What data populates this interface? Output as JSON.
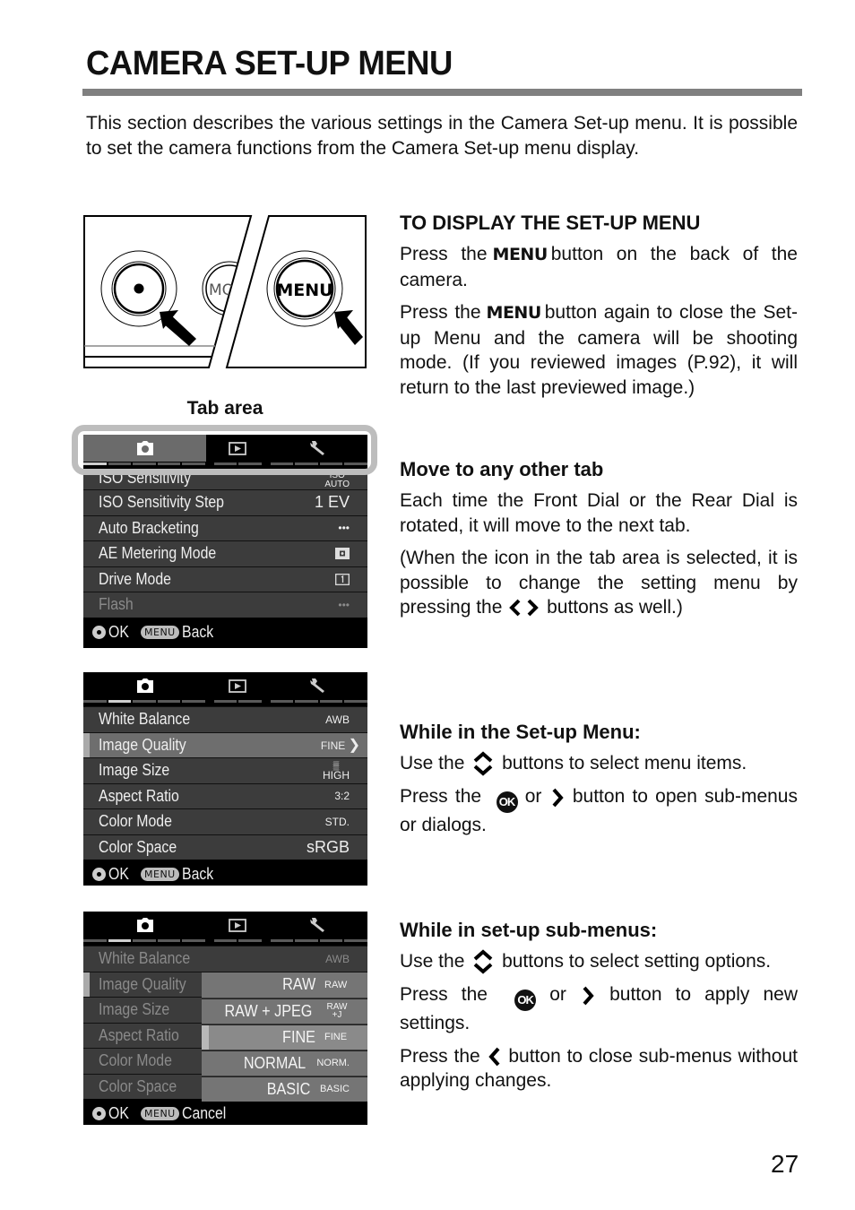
{
  "page": {
    "title": "CAMERA SET-UP MENU",
    "intro": "This section describes the various settings in the Camera Set-up menu. It is possible to set the camera functions from the Camera Set-up menu display.",
    "page_number": "27"
  },
  "camera_illustration": {
    "left_button_label": "MO",
    "menu_button_label": "MENU"
  },
  "tab_area_label": "Tab area",
  "sections": {
    "display": {
      "heading": "TO DISPLAY THE SET-UP MENU",
      "p1_before": "Press the",
      "p1_key": "MENU",
      "p1_after": "button on the back of the camera.",
      "p2_before": "Press the",
      "p2_key": "MENU",
      "p2_after": "button again to close the Set-up Menu and the camera will be shooting mode. (If you reviewed images (P.92), it will return to the last previewed image.)"
    },
    "tabs": {
      "heading": "Move to any other tab",
      "p1": "Each time the Front Dial or the Rear Dial is rotated, it will move to the next tab.",
      "p2_before": "(When the icon in the tab area is selected, it is possible to change the setting menu by pressing the",
      "p2_after": "buttons as well.)"
    },
    "menu": {
      "heading": "While in the Set-up Menu:",
      "p1_before": "Use the",
      "p1_after": "buttons to select menu items.",
      "p2_before": "Press the",
      "p2_ok": "OK",
      "p2_mid": "or",
      "p2_after": "button to open sub-menus or dialogs."
    },
    "submenu": {
      "heading": "While in set-up sub-menus:",
      "p1_before": "Use the",
      "p1_after": "buttons to select setting options.",
      "p2_before": "Press the",
      "p2_ok": "OK",
      "p2_mid": "or",
      "p2_after": "button to apply new settings.",
      "p3_before": "Press the",
      "p3_after": "button to close sub-menus without applying changes."
    }
  },
  "screens": {
    "screen1": {
      "rows": [
        {
          "label": "ISO Sensitivity",
          "value": "ISO AUTO"
        },
        {
          "label": "ISO Sensitivity Step",
          "value": "1 EV"
        },
        {
          "label": "Auto Bracketing",
          "value": "•••"
        },
        {
          "label": "AE Metering Mode",
          "value": "metering-icon"
        },
        {
          "label": "Drive Mode",
          "value": "single-shot-icon"
        },
        {
          "label": "Flash",
          "value": "•••"
        }
      ],
      "footer": {
        "ok": "OK",
        "menu": "MENU",
        "action": "Back"
      }
    },
    "screen2": {
      "rows": [
        {
          "label": "White Balance",
          "value": "AWB"
        },
        {
          "label": "Image Quality",
          "value": "FINE"
        },
        {
          "label": "Image Size",
          "value": "HIGH"
        },
        {
          "label": "Aspect Ratio",
          "value": "3:2"
        },
        {
          "label": "Color Mode",
          "value": "STD."
        },
        {
          "label": "Color Space",
          "value": "sRGB"
        }
      ],
      "footer": {
        "ok": "OK",
        "menu": "MENU",
        "action": "Back"
      }
    },
    "screen3": {
      "rows": [
        {
          "label": "White Balance",
          "value": "AWB"
        },
        {
          "label": "Image Quality"
        },
        {
          "label": "Image Size"
        },
        {
          "label": "Aspect Ratio"
        },
        {
          "label": "Color Mode"
        },
        {
          "label": "Color Space"
        }
      ],
      "options": [
        {
          "label": "RAW",
          "badge": "RAW"
        },
        {
          "label": "RAW + JPEG",
          "badge": "RAW +J"
        },
        {
          "label": "FINE",
          "badge": "FINE"
        },
        {
          "label": "NORMAL",
          "badge": "NORM."
        },
        {
          "label": "BASIC",
          "badge": "BASIC"
        }
      ],
      "footer": {
        "ok": "OK",
        "menu": "MENU",
        "action": "Cancel"
      }
    }
  }
}
